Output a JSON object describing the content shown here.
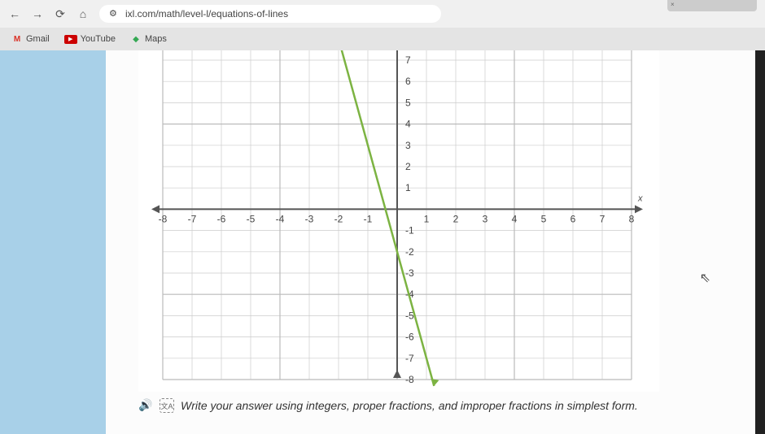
{
  "browser": {
    "url": "ixl.com/math/level-l/equations-of-lines",
    "tab_fragment": "× "
  },
  "bookmarks": {
    "gmail": "Gmail",
    "youtube": "YouTube",
    "maps": "Maps"
  },
  "chart_data": {
    "type": "line",
    "title": "",
    "xlabel": "x",
    "ylabel": "",
    "xlim": [
      -8,
      8
    ],
    "ylim": [
      -8,
      8
    ],
    "x_ticks": [
      -8,
      -7,
      -6,
      -5,
      -4,
      -3,
      -2,
      -1,
      1,
      2,
      3,
      4,
      5,
      6,
      7,
      8
    ],
    "y_ticks": [
      -8,
      -7,
      -6,
      -5,
      -4,
      -3,
      -2,
      -1,
      1,
      2,
      3,
      4,
      5,
      6,
      7
    ],
    "grid": true,
    "series": [
      {
        "name": "line",
        "color": "#7cb342",
        "points": [
          {
            "x": -2,
            "y": 8
          },
          {
            "x": -1,
            "y": 3
          },
          {
            "x": 0,
            "y": -2
          },
          {
            "x": 1,
            "y": -7
          }
        ],
        "equation_hint": "y = -5x - 2"
      }
    ]
  },
  "prompt": {
    "text": "Write your answer using integers, proper fractions, and improper fractions in simplest form."
  }
}
